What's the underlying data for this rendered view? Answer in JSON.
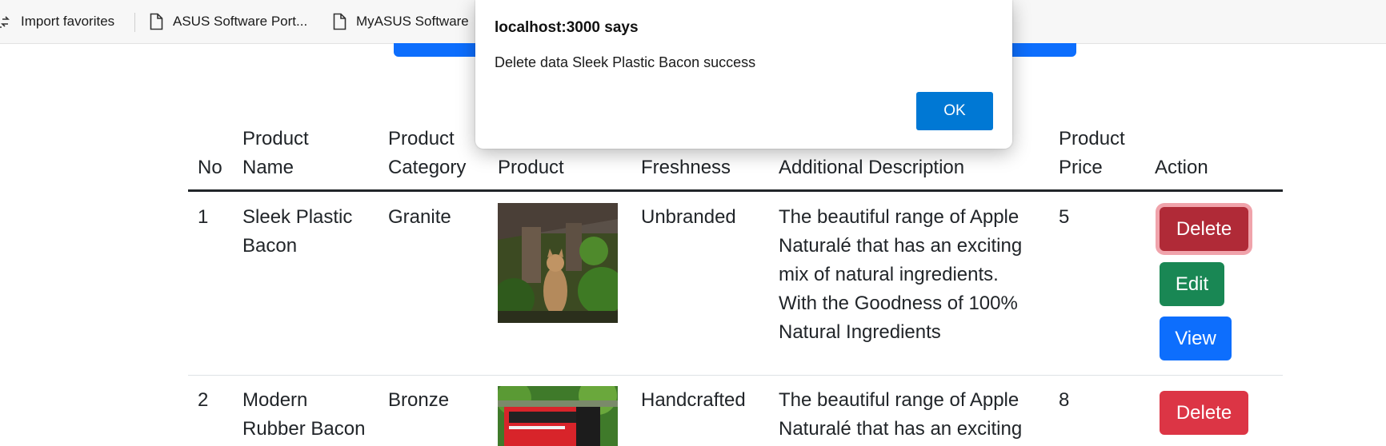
{
  "bookmarks": [
    {
      "label": "Import favorites",
      "icon": "import-icon"
    },
    {
      "label": "ASUS Software Port...",
      "icon": "page-icon"
    },
    {
      "label": "MyASUS Software",
      "icon": "page-icon"
    }
  ],
  "table": {
    "headers": {
      "no": "No",
      "name_1": "Product",
      "name_2": "Name",
      "category_1": "Product",
      "category_2": "Category",
      "image_2": "Product",
      "freshness": "Freshness",
      "description": "Additional Description",
      "price_1": "Product",
      "price_2": "Price",
      "action": "Action"
    },
    "rows": [
      {
        "no": "1",
        "name_lines": [
          "Sleek Plastic",
          "Bacon"
        ],
        "category": "Granite",
        "image": "cat photo",
        "freshness": "Unbranded",
        "description_lines": [
          "The beautiful range of Apple",
          "Naturalé that has an exciting",
          "mix of natural ingredients.",
          "With the Goodness of 100%",
          "Natural Ingredients"
        ],
        "price": "5",
        "actions": {
          "delete": "Delete",
          "edit": "Edit",
          "view": "View"
        }
      },
      {
        "no": "2",
        "name_lines": [
          "Modern",
          "Rubber Bacon"
        ],
        "category": "Bronze",
        "image": "red bus photo",
        "freshness": "Handcrafted",
        "description_lines": [
          "The beautiful range of Apple",
          "Naturalé that has an exciting"
        ],
        "price": "8",
        "actions": {
          "delete": "Delete"
        }
      }
    ]
  },
  "dialog": {
    "title": "localhost:3000 says",
    "message": "Delete data Sleek Plastic Bacon success",
    "ok_label": "OK"
  },
  "colors": {
    "danger": "#dc3545",
    "success": "#198754",
    "primary": "#0d6efd",
    "dialog_ok": "#0078d4"
  }
}
